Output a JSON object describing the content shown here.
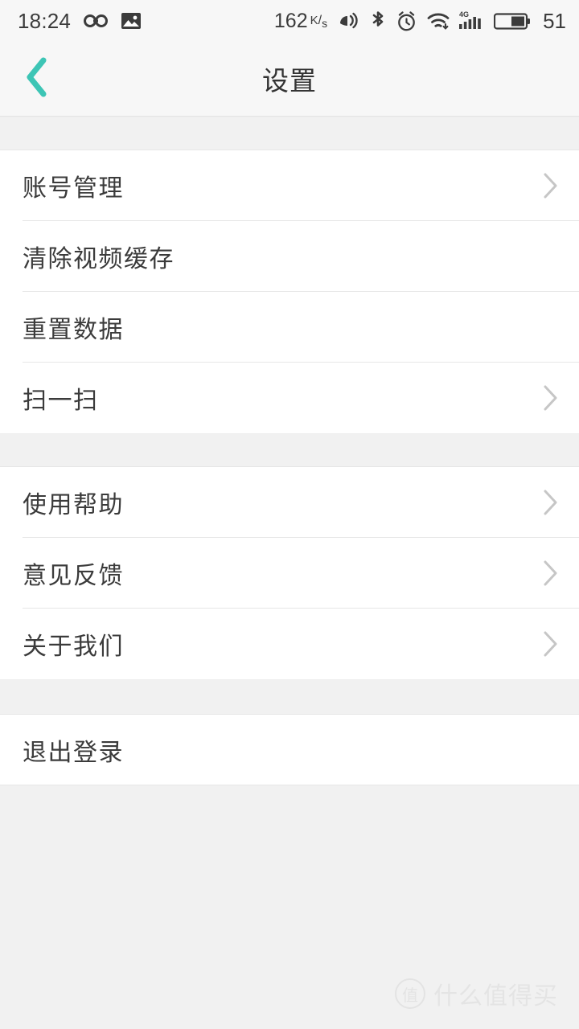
{
  "status_bar": {
    "time": "18:24",
    "left_icons": [
      "infinity-icon",
      "image-icon"
    ],
    "network_speed": "162",
    "network_speed_unit_top": "K",
    "network_speed_unit_bottom": "s",
    "right_icons": [
      "vibrate-icon",
      "bluetooth-icon",
      "alarm-icon",
      "wifi-icon",
      "signal-4g-icon",
      "battery-icon"
    ],
    "network_type": "4G",
    "battery_level": "51"
  },
  "header": {
    "title": "设置",
    "back_icon": "chevron-left-icon",
    "back_color": "#3dc5b5"
  },
  "sections": [
    {
      "rows": [
        {
          "label": "账号管理",
          "chevron": true
        },
        {
          "label": "清除视频缓存",
          "chevron": false
        },
        {
          "label": "重置数据",
          "chevron": false
        },
        {
          "label": "扫一扫",
          "chevron": true
        }
      ]
    },
    {
      "rows": [
        {
          "label": "使用帮助",
          "chevron": true
        },
        {
          "label": "意见反馈",
          "chevron": true
        },
        {
          "label": "关于我们",
          "chevron": true
        }
      ]
    },
    {
      "rows": [
        {
          "label": "退出登录",
          "chevron": false
        }
      ]
    }
  ],
  "watermark": {
    "badge": "值",
    "text": "什么值得买"
  },
  "colors": {
    "accent": "#3dc5b5",
    "text": "#3b3b3b",
    "divider": "#e6e6e6",
    "group_bg": "#ffffff",
    "page_bg": "#f1f1f1",
    "bar_bg": "#f7f7f7"
  }
}
